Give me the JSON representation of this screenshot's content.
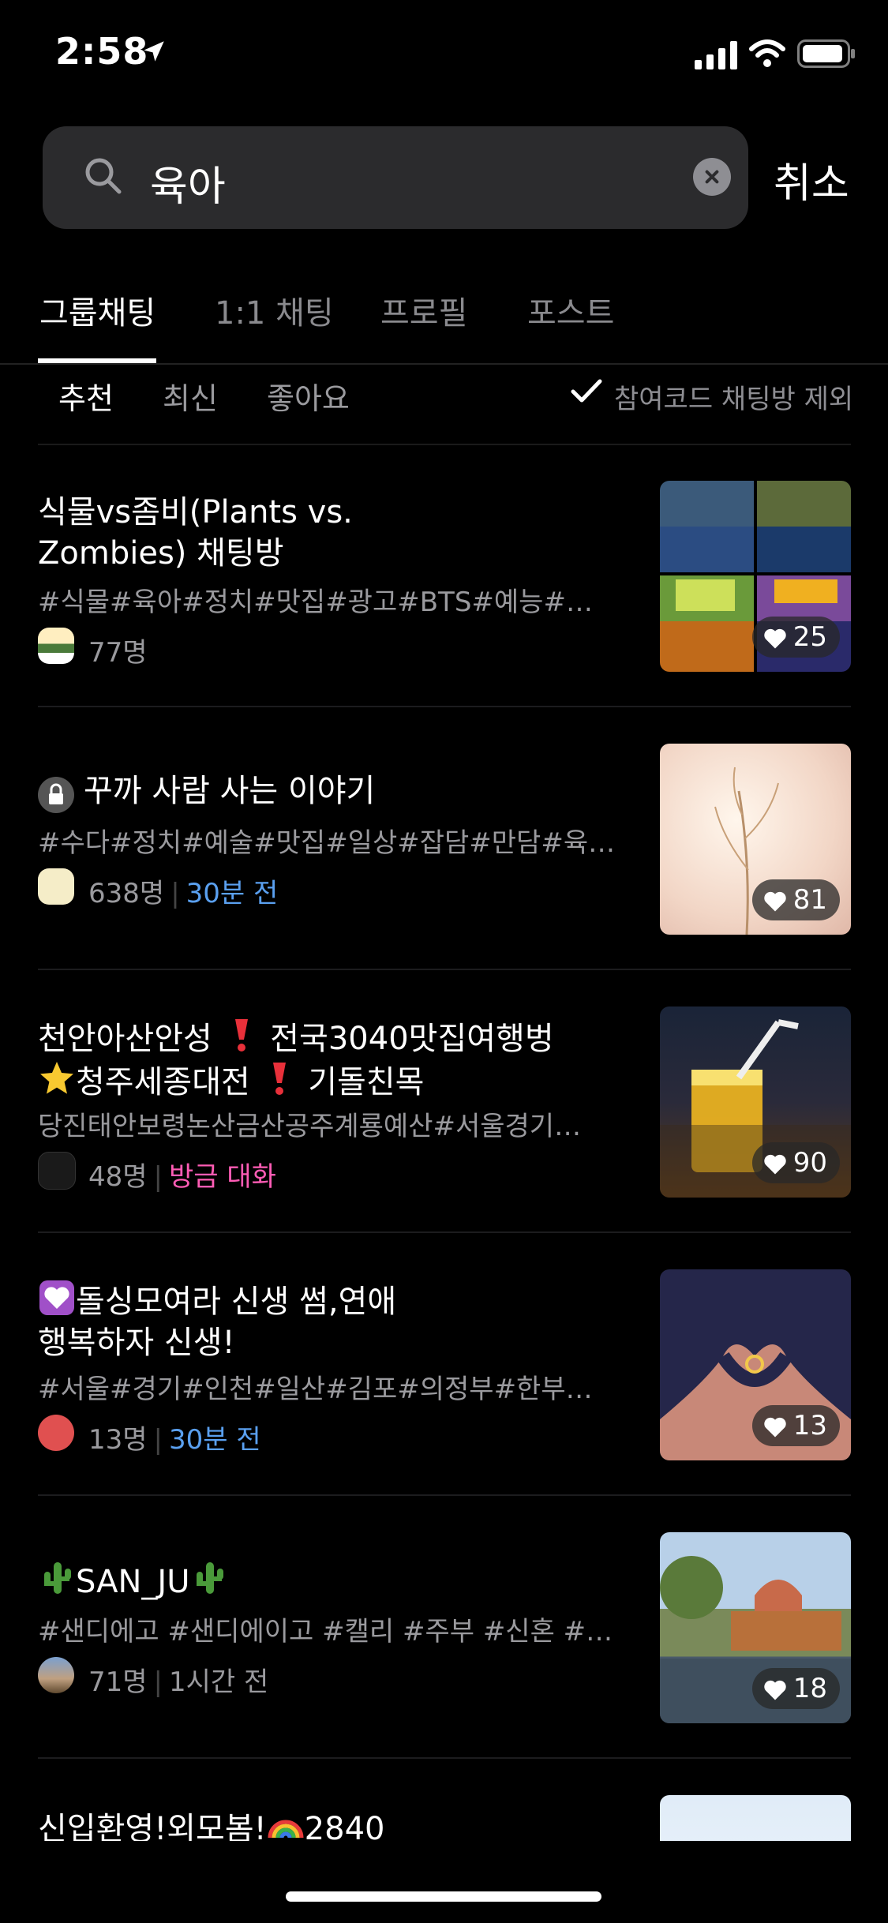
{
  "status_bar": {
    "time": "2:58"
  },
  "search": {
    "query": "육아",
    "cancel_label": "취소"
  },
  "tabs": [
    {
      "label": "그룹채팅",
      "active": true
    },
    {
      "label": "1:1 채팅",
      "active": false
    },
    {
      "label": "프로필",
      "active": false
    },
    {
      "label": "포스트",
      "active": false
    }
  ],
  "filters": {
    "items": [
      {
        "label": "추천"
      },
      {
        "label": "최신"
      },
      {
        "label": "좋아요"
      }
    ],
    "exclude_label": "참여코드 채팅방 제외"
  },
  "rooms": [
    {
      "title_line1": "식물vs좀비(Plants vs.",
      "title_line2": "Zombies) 채팅방",
      "tags": "#식물#육아#정치#맛집#광고#BTS#예능#…",
      "members": "77명",
      "likes": "25"
    },
    {
      "title": "꾸까 사람 사는 이야기",
      "tags": "#수다#정치#예술#맛집#일상#잡담#만담#육…",
      "members": "638명",
      "time": "30분 전",
      "likes": "81"
    },
    {
      "title_line1_a": "천안아산안성",
      "title_line1_b": "전국3040맛집여행벙",
      "title_line2_a": "청주세종대전",
      "title_line2_b": "기돌친목",
      "tags": "당진태안보령논산금산공주계룡예산#서울경기…",
      "members": "48명",
      "status": "방금 대화",
      "likes": "90"
    },
    {
      "title_line1": "돌싱모여라 신생 썸,연애",
      "title_line2": "행복하자  신생!",
      "tags": "#서울#경기#인천#일산#김포#의정부#한부…",
      "members": "13명",
      "time": "30분 전",
      "likes": "13"
    },
    {
      "title": "SAN_JU",
      "tags": "#샌디에고 #샌디에이고 #캘리 #주부 #신혼 #…",
      "members": "71명",
      "time": "1시간 전",
      "likes": "18"
    },
    {
      "title_a": "신입환영!외모봄!",
      "title_b": "2840"
    }
  ]
}
